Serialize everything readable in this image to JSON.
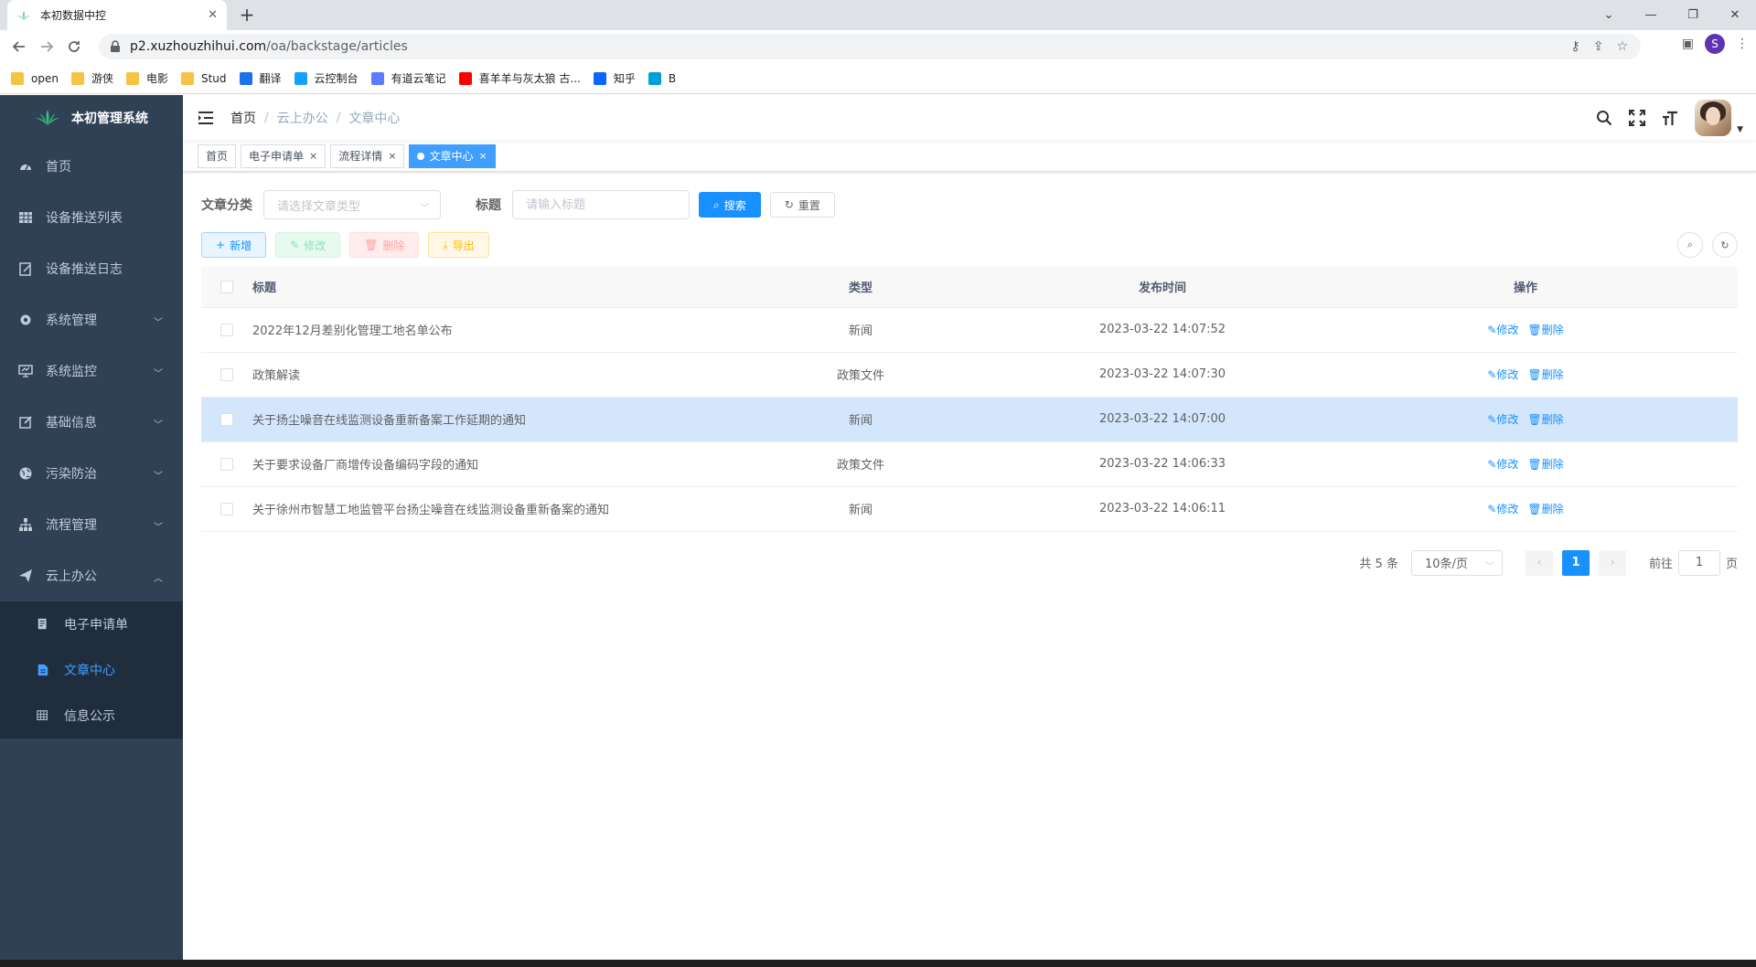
{
  "browser": {
    "tab_title": "本初数据中控",
    "url_host": "p2.xuzhouzhihui.com",
    "url_path": "/oa/backstage/articles",
    "profile_initial": "S",
    "bookmarks": [
      {
        "label": "open",
        "type": "folder"
      },
      {
        "label": "游侠",
        "type": "folder"
      },
      {
        "label": "电影",
        "type": "folder"
      },
      {
        "label": "Stud",
        "type": "folder"
      },
      {
        "label": "翻译",
        "type": "translate"
      },
      {
        "label": "云控制台",
        "type": "cloud"
      },
      {
        "label": "有道云笔记",
        "type": "note"
      },
      {
        "label": "喜羊羊与灰太狼 古...",
        "type": "youtube"
      },
      {
        "label": "知乎",
        "type": "zhihu"
      },
      {
        "label": "B",
        "type": "bilibili"
      }
    ]
  },
  "sidebar": {
    "logo_text": "本初管理系统",
    "items": [
      {
        "label": "首页",
        "icon": "dashboard-icon",
        "arrow": ""
      },
      {
        "label": "设备推送列表",
        "icon": "table-icon",
        "arrow": ""
      },
      {
        "label": "设备推送日志",
        "icon": "edit-doc-icon",
        "arrow": ""
      },
      {
        "label": "系统管理",
        "icon": "gear-icon",
        "arrow": "﹀"
      },
      {
        "label": "系统监控",
        "icon": "monitor-icon",
        "arrow": "﹀"
      },
      {
        "label": "基础信息",
        "icon": "edit-icon",
        "arrow": "﹀"
      },
      {
        "label": "污染防治",
        "icon": "globe-icon",
        "arrow": "﹀"
      },
      {
        "label": "流程管理",
        "icon": "tree-icon",
        "arrow": "﹀"
      },
      {
        "label": "云上办公",
        "icon": "send-icon",
        "arrow": "︿"
      }
    ],
    "subitems": [
      {
        "label": "电子申请单",
        "icon": "form-icon"
      },
      {
        "label": "文章中心",
        "icon": "document-icon"
      },
      {
        "label": "信息公示",
        "icon": "grid-icon"
      }
    ]
  },
  "navbar": {
    "breadcrumb": [
      "首页",
      "云上办公",
      "文章中心"
    ]
  },
  "tags": [
    {
      "label": "首页",
      "closable": false,
      "active": false
    },
    {
      "label": "电子申请单",
      "closable": true,
      "active": false
    },
    {
      "label": "流程详情",
      "closable": true,
      "active": false
    },
    {
      "label": "文章中心",
      "closable": true,
      "active": true
    }
  ],
  "search": {
    "category_label": "文章分类",
    "category_placeholder": "请选择文章类型",
    "title_label": "标题",
    "title_placeholder": "请输入标题",
    "search_btn": "搜索",
    "reset_btn": "重置"
  },
  "toolbar": {
    "add": "新增",
    "edit": "修改",
    "delete": "删除",
    "export": "导出"
  },
  "table": {
    "headers": [
      "标题",
      "类型",
      "发布时间",
      "操作"
    ],
    "rows": [
      {
        "title": "2022年12月差别化管理工地名单公布",
        "type": "新闻",
        "time": "2023-03-22 14:07:52",
        "highlight": false
      },
      {
        "title": "政策解读",
        "type": "政策文件",
        "time": "2023-03-22 14:07:30",
        "highlight": false
      },
      {
        "title": "关于扬尘噪音在线监测设备重新备案工作延期的通知",
        "type": "新闻",
        "time": "2023-03-22 14:07:00",
        "highlight": true
      },
      {
        "title": "关于要求设备厂商增传设备编码字段的通知",
        "type": "政策文件",
        "time": "2023-03-22 14:06:33",
        "highlight": false
      },
      {
        "title": "关于徐州市智慧工地监管平台扬尘噪音在线监测设备重新备案的通知",
        "type": "新闻",
        "time": "2023-03-22 14:06:11",
        "highlight": false
      }
    ],
    "action_edit": "修改",
    "action_delete": "删除"
  },
  "pagination": {
    "total_text": "共 5 条",
    "page_size": "10条/页",
    "current_page": "1",
    "goto_label": "前往",
    "goto_value": "1",
    "page_suffix": "页"
  },
  "colors": {
    "sidebar_bg": "#304156",
    "submenu_bg": "#1f2d3d",
    "primary": "#1890ff",
    "row_highlight": "#d3e6fb"
  }
}
